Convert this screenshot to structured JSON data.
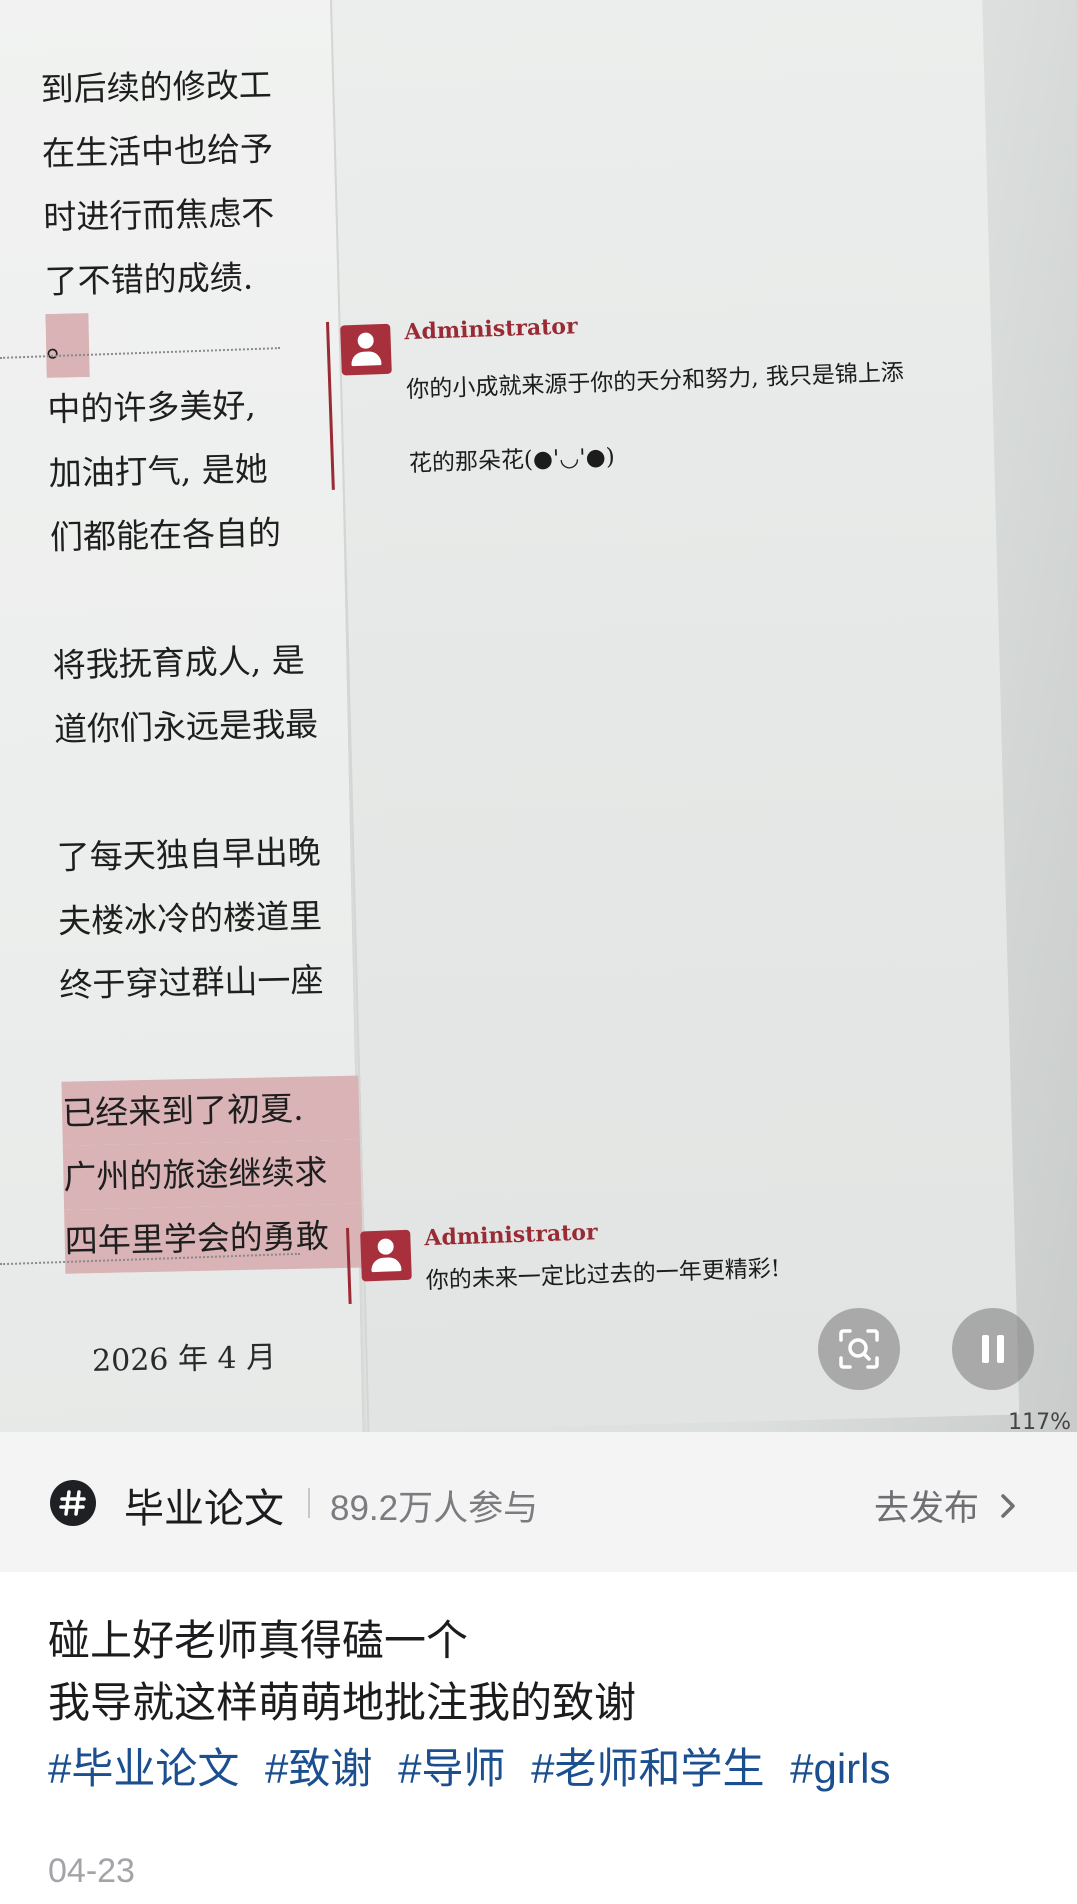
{
  "document": {
    "lines": [
      {
        "text": "到后续的修改工",
        "style": "normal"
      },
      {
        "text": "在生活中也给予",
        "style": "normal"
      },
      {
        "text": "时进行而焦虑不",
        "style": "normal"
      },
      {
        "text": "了不错的成绩.",
        "style": "normal"
      },
      {
        "text": "。",
        "style": "hl-short"
      },
      {
        "text": "中的许多美好,",
        "style": "normal"
      },
      {
        "text": "加油打气, 是她",
        "style": "normal"
      },
      {
        "text": "们都能在各自的",
        "style": "normal"
      },
      {
        "text": "",
        "style": "gap"
      },
      {
        "text": "将我抚育成人, 是",
        "style": "normal"
      },
      {
        "text": "道你们永远是我最",
        "style": "normal"
      },
      {
        "text": "",
        "style": "gap"
      },
      {
        "text": "了每天独自早出晚",
        "style": "normal"
      },
      {
        "text": "夫楼冰冷的楼道里",
        "style": "normal"
      },
      {
        "text": "终于穿过群山一座",
        "style": "normal"
      },
      {
        "text": "",
        "style": "gap"
      },
      {
        "text": "已经来到了初夏.",
        "style": "hl"
      },
      {
        "text": "广州的旅途继续求",
        "style": "hl"
      },
      {
        "text": "四年里学会的勇敢",
        "style": "hl"
      }
    ],
    "date": "2026 年 4 月"
  },
  "comments": [
    {
      "author": "Administrator",
      "line1": "你的小成就来源于你的天分和努力, 我只是锦上添",
      "line2": "花的那朵花(●'◡'●)"
    },
    {
      "author": "Administrator",
      "line1": "你的未来一定比过去的一年更精彩!",
      "line2": ""
    }
  ],
  "statusbar": {
    "zoom": "117%"
  },
  "topic": {
    "name": "毕业论文",
    "count": "89.2万人参与",
    "action": "去发布"
  },
  "post": {
    "lines": [
      "碰上好老师真得磕一个",
      "我导就这样萌萌地批注我的致谢"
    ],
    "hashtags": [
      "#毕业论文",
      "#致谢",
      "#导师",
      "#老师和学生",
      "#girls"
    ],
    "date": "04-23"
  },
  "colors": {
    "comment_accent": "#9a2b35",
    "highlight": "#d9b3b6",
    "hashtag": "#1c4f8f",
    "topic_bg": "#f4f4f5"
  },
  "icons": [
    "user-avatar-icon",
    "visual-search-icon",
    "pause-icon",
    "hashtag-icon",
    "chevron-right-icon"
  ]
}
